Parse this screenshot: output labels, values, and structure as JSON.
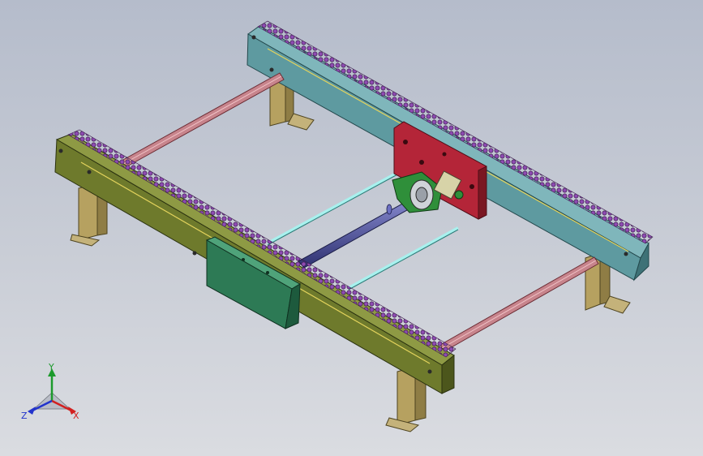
{
  "viewport": {
    "background_top": "#b5bccb",
    "background_bottom": "#dadce1"
  },
  "model": {
    "colors": {
      "front_rail": "#6e7a2c",
      "back_rail": "#5e9aa0",
      "chain": "#7d3f9c",
      "tie_rod": "#c7848c",
      "cross_rod": "#a8f1ee",
      "drive_shaft": "#4b4f9a",
      "motor_plate": "#b42538",
      "motor_box": "#2d7a55",
      "support_leg": "#b6a160",
      "bearing": "#2f8f3a"
    },
    "icons": [
      "support-leg-icon",
      "chain-icon",
      "motor-plate-icon"
    ]
  },
  "triad": {
    "x_label": "X",
    "y_label": "Y",
    "z_label": "Z",
    "x_color": "#d22020",
    "y_color": "#1c9a2c",
    "z_color": "#2233cc"
  }
}
